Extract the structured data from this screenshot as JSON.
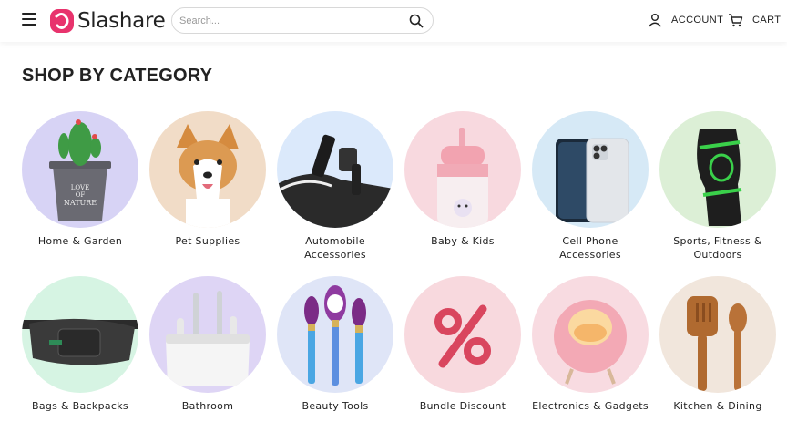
{
  "header": {
    "brand": "Slashare",
    "search_placeholder": "Search...",
    "account_label": "ACCOUNT",
    "cart_label": "CART",
    "accent": "#e8336d"
  },
  "section": {
    "title": "SHOP BY CATEGORY"
  },
  "categories": [
    {
      "label": "Home & Garden",
      "bg": "#d7d3f5",
      "icon": "cactus-pot-icon"
    },
    {
      "label": "Pet Supplies",
      "bg": "#f1dcc7",
      "icon": "corgi-icon"
    },
    {
      "label": "Automobile Accessories",
      "bg": "#dbe9fb",
      "icon": "car-phone-holder-icon"
    },
    {
      "label": "Baby & Kids",
      "bg": "#f8d9df",
      "icon": "sippy-cup-icon"
    },
    {
      "label": "Cell Phone Accessories",
      "bg": "#d6e9f6",
      "icon": "phone-case-icon"
    },
    {
      "label": "Sports, Fitness & Outdoors",
      "bg": "#dcefd6",
      "icon": "knee-brace-icon"
    },
    {
      "label": "Bags & Backpacks",
      "bg": "#d6f4e3",
      "icon": "waist-bag-icon"
    },
    {
      "label": "Bathroom",
      "bg": "#ded5f5",
      "icon": "toothbrush-holder-icon"
    },
    {
      "label": "Beauty Tools",
      "bg": "#dfe5f7",
      "icon": "makeup-brushes-icon"
    },
    {
      "label": "Bundle Discount",
      "bg": "#f8d9de",
      "icon": "percent-icon"
    },
    {
      "label": "Electronics & Gadgets",
      "bg": "#f8dbe1",
      "icon": "night-lamp-icon"
    },
    {
      "label": "Kitchen & Dining",
      "bg": "#f1e6dc",
      "icon": "wooden-utensils-icon"
    }
  ]
}
